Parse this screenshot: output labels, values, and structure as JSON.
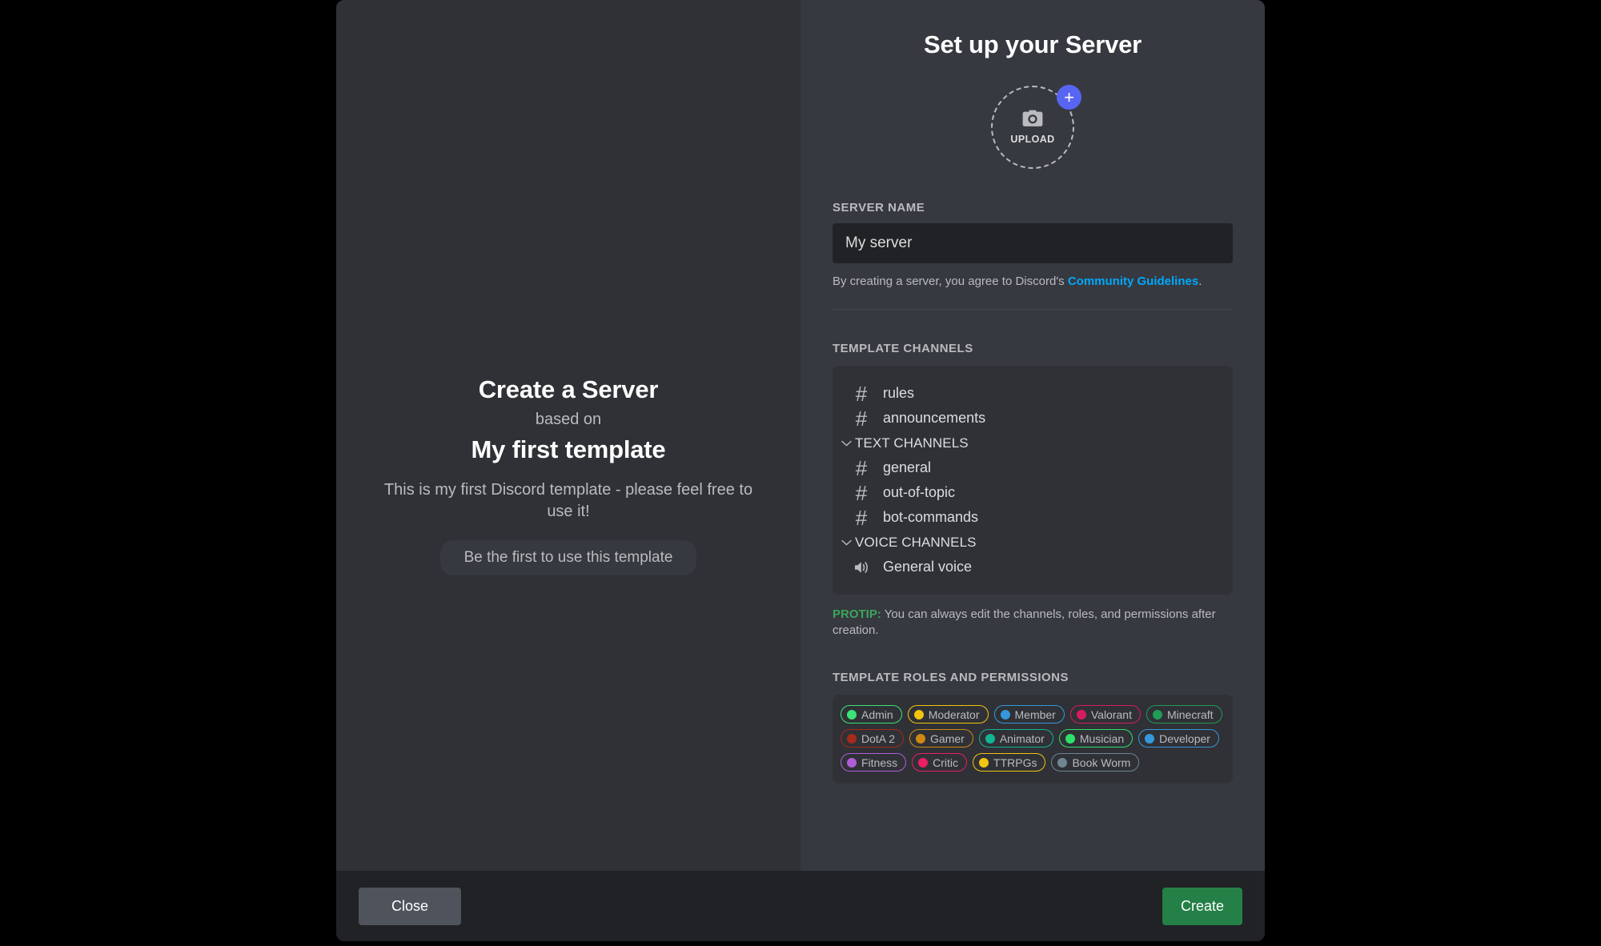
{
  "left_panel": {
    "heading": "Create a Server",
    "based_on": "based on",
    "template_name": "My first template",
    "description": "This is my first Discord template - please feel free to use it!",
    "usage_pill": "Be the first to use this template"
  },
  "right_panel": {
    "title": "Set up your Server",
    "upload": {
      "label": "UPLOAD",
      "plus": "+",
      "camera_icon": "camera-icon"
    },
    "server_name": {
      "label": "SERVER NAME",
      "value": "My server",
      "placeholder": "My server"
    },
    "guidelines": {
      "prefix": "By creating a server, you agree to Discord's ",
      "link": "Community Guidelines",
      "suffix": "."
    },
    "channels_section": {
      "label": "TEMPLATE CHANNELS",
      "items": [
        {
          "type": "text",
          "name": "rules"
        },
        {
          "type": "text",
          "name": "announcements"
        },
        {
          "type": "category",
          "name": "TEXT CHANNELS"
        },
        {
          "type": "text",
          "name": "general"
        },
        {
          "type": "text",
          "name": "out-of-topic"
        },
        {
          "type": "text",
          "name": "bot-commands"
        },
        {
          "type": "category",
          "name": "VOICE CHANNELS"
        },
        {
          "type": "voice",
          "name": "General voice"
        }
      ]
    },
    "protip": {
      "key": "PROTIP:",
      "text": " You can always edit the channels, roles, and permissions after creation."
    },
    "roles_section": {
      "label": "TEMPLATE ROLES AND PERMISSIONS",
      "roles": [
        {
          "name": "Admin",
          "color": "#3ae374"
        },
        {
          "name": "Moderator",
          "color": "#f1c40f"
        },
        {
          "name": "Member",
          "color": "#3498db"
        },
        {
          "name": "Valorant",
          "color": "#d81b60"
        },
        {
          "name": "Minecraft",
          "color": "#1f9d55"
        },
        {
          "name": "DotA 2",
          "color": "#a62b18"
        },
        {
          "name": "Gamer",
          "color": "#d08812"
        },
        {
          "name": "Animator",
          "color": "#11b495"
        },
        {
          "name": "Musician",
          "color": "#2ee06a"
        },
        {
          "name": "Developer",
          "color": "#3498db"
        },
        {
          "name": "Fitness",
          "color": "#b15cd8"
        },
        {
          "name": "Critic",
          "color": "#e91e63"
        },
        {
          "name": "TTRPGs",
          "color": "#f1c40f"
        },
        {
          "name": "Book Worm",
          "color": "#6e8694"
        }
      ]
    }
  },
  "footer": {
    "close_label": "Close",
    "create_label": "Create"
  },
  "theme": {
    "modal_bg": "#2f3136",
    "panel_bg": "#36393f",
    "footer_bg": "#202225",
    "accent_blurple": "#5865f2",
    "accent_green": "#248046",
    "link_blue": "#00a8fc",
    "protip_green": "#3ba55d"
  }
}
